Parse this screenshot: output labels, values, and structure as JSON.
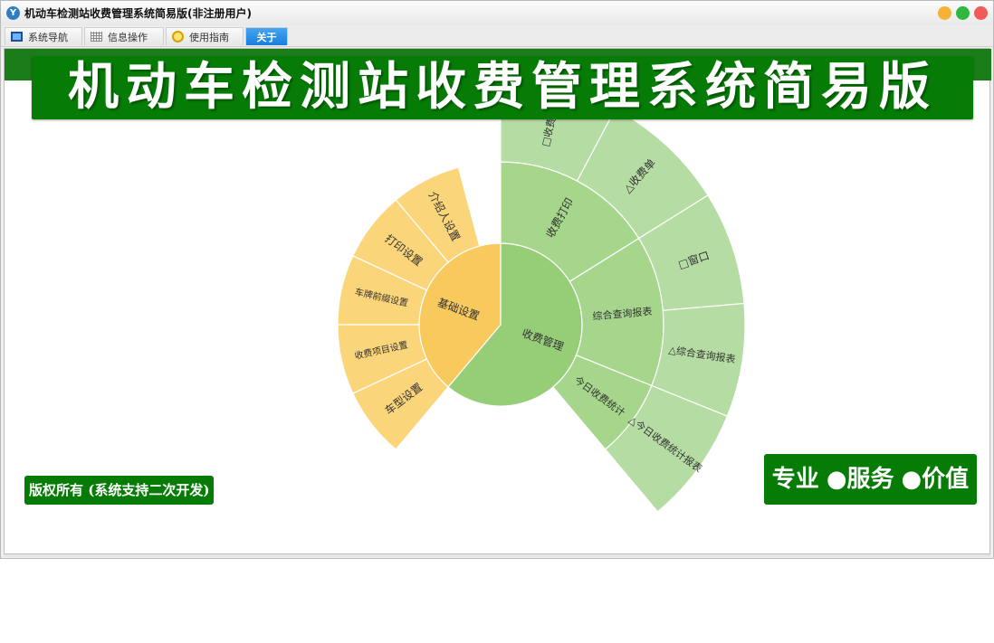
{
  "window": {
    "title": "机动车检测站收费管理系统简易版(非注册用户)",
    "app_icon": "Y"
  },
  "tabs": [
    {
      "label": "系统导航",
      "icon": "monitor-icon"
    },
    {
      "label": "信息操作",
      "icon": "grid-icon"
    },
    {
      "label": "使用指南",
      "icon": "help-icon"
    },
    {
      "label": "关于",
      "icon": ""
    }
  ],
  "banner": {
    "title": "机动车检测站收费管理系统简易版"
  },
  "copyright": {
    "text": "版权所有 (系统支持二次开发)"
  },
  "slogan": {
    "part1": "专业",
    "part2": "●服务",
    "part3": "●价值"
  },
  "colors": {
    "banner_green": "#067c06",
    "sunburst_orange_inner": "#f8c95c",
    "sunburst_orange_outer": "#fbd57a",
    "sunburst_green_inner": "#96ce78",
    "sunburst_green_mid": "#a5d68c",
    "sunburst_green_outer": "#b5dca3"
  },
  "sunburst": {
    "inner": [
      "基础设置",
      "收费管理"
    ],
    "middle": [
      "介绍人设置",
      "打印设置",
      "车牌前缀设置",
      "收费项目设置",
      "车型设置",
      "收费打印",
      "综合查询报表",
      "今日收费统计"
    ],
    "outer": [
      "□收费回",
      "△收费单",
      "□窗口",
      "△综合查询报表",
      "△今日收费统计报表"
    ]
  }
}
